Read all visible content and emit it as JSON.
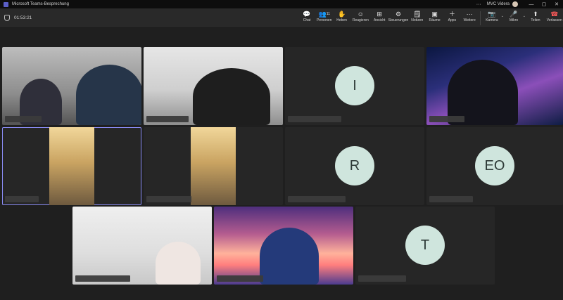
{
  "window": {
    "title": "Microsoft Teams-Besprechung",
    "account": "MVC Videra"
  },
  "meeting": {
    "elapsed": "01:53:21"
  },
  "toolbar": {
    "chat": "Chat",
    "people": "Personen",
    "people_count": "11",
    "raise": "Heben",
    "react": "Reagieren",
    "view": "Ansicht",
    "controls": "Steuerungen",
    "notes": "Notizen",
    "rooms": "Räume",
    "apps": "Apps",
    "more": "Weitere",
    "camera": "Kamera",
    "mic": "Mikro",
    "share": "Teilen",
    "leave": "Verlassen"
  },
  "participants": {
    "avatars": [
      "I",
      "R",
      "EO",
      "T"
    ]
  },
  "colors": {
    "selected_border": "#8a8cf5",
    "avatar_bg": "#cfe5dd",
    "leave": "#ff5a5a"
  }
}
